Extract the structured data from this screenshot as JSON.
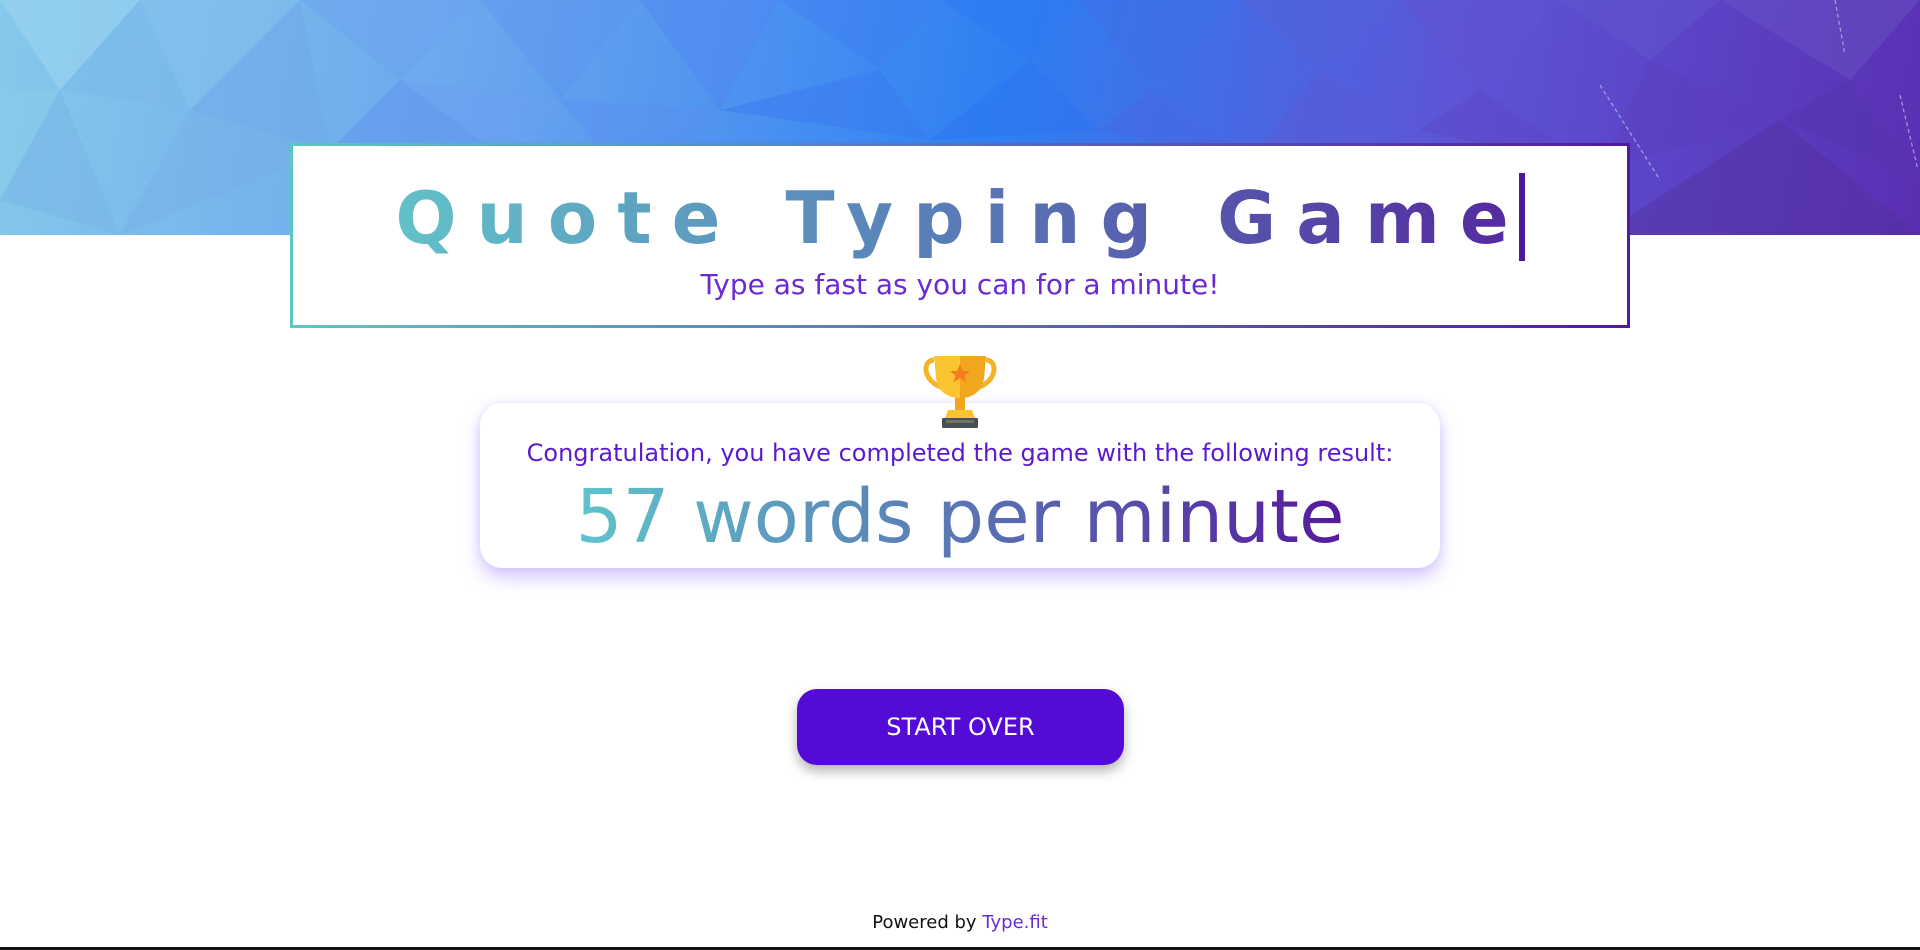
{
  "header": {
    "title": "Quote Typing Game",
    "subtitle": "Type as fast as you can for a minute!"
  },
  "result": {
    "message": "Congratulation, you have completed the game with the following result:",
    "wpm_text": "57 words per minute"
  },
  "actions": {
    "start_over_label": "START OVER"
  },
  "footer": {
    "prefix": "Powered by ",
    "link_text": "Type.fit"
  },
  "icons": {
    "trophy": "trophy-icon"
  },
  "colors": {
    "primary": "#540bd6",
    "accent_purple": "#6a2bd0",
    "gradient_start": "#5cc6c3",
    "gradient_end": "#55199c"
  }
}
